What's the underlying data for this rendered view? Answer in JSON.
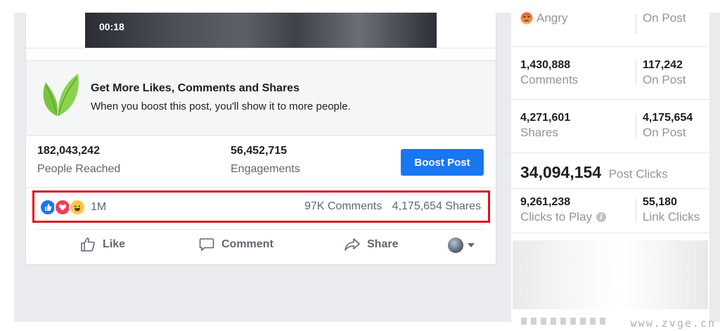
{
  "post": {
    "video": {
      "timestamp": "00:18"
    },
    "boost_promo": {
      "title": "Get More Likes, Comments and Shares",
      "subtitle": "When you boost this post, you'll show it to more people."
    },
    "stats": [
      {
        "value": "182,043,242",
        "label": "People Reached"
      },
      {
        "value": "56,452,715",
        "label": "Engagements"
      }
    ],
    "boost_button": "Boost Post",
    "reactions": {
      "icons": [
        "like-icon",
        "love-icon",
        "haha-icon"
      ],
      "count": "1M",
      "comments": "97K Comments",
      "shares": "4,175,654 Shares"
    },
    "actions": {
      "like": "Like",
      "comment": "Comment",
      "share": "Share"
    }
  },
  "insights": {
    "rows": [
      {
        "left": {
          "value": "",
          "label": "Angry",
          "icon": "angry-icon"
        },
        "right": {
          "value": "",
          "label": "On Post"
        }
      },
      {
        "left": {
          "value": "1,430,888",
          "label": "Comments"
        },
        "right": {
          "value": "117,242",
          "label": "On Post"
        }
      },
      {
        "left": {
          "value": "4,271,601",
          "label": "Shares"
        },
        "right": {
          "value": "4,175,654",
          "label": "On Post"
        }
      }
    ],
    "post_clicks": {
      "value": "34,094,154",
      "label": "Post Clicks"
    },
    "clicks": {
      "left": {
        "value": "9,261,238",
        "label": "Clicks to Play",
        "icon": "info-icon"
      },
      "right": {
        "value": "55,180",
        "label": "Link Clicks"
      }
    }
  },
  "watermark": "www.zvge.cn",
  "colors": {
    "accent": "#1877f2",
    "highlight": "#e0101b",
    "muted": "#90949c"
  }
}
